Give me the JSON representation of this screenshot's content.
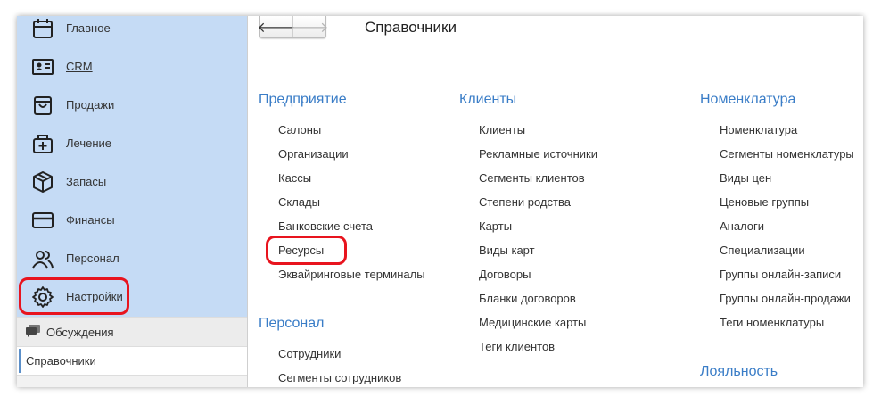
{
  "sidebar": {
    "items": [
      {
        "label": "Главное",
        "icon": "calendar-icon"
      },
      {
        "label": "CRM",
        "icon": "id-card-icon"
      },
      {
        "label": "Продажи",
        "icon": "shopping-bag-icon"
      },
      {
        "label": "Лечение",
        "icon": "medical-bag-icon"
      },
      {
        "label": "Запасы",
        "icon": "box-icon"
      },
      {
        "label": "Финансы",
        "icon": "credit-card-icon"
      },
      {
        "label": "Персонал",
        "icon": "users-icon"
      },
      {
        "label": "Настройки",
        "icon": "gear-icon"
      }
    ],
    "discussions_label": "Обсуждения",
    "current_label": "Справочники"
  },
  "header": {
    "back_glyph": "🡐",
    "forward_glyph": "🡒",
    "title": "Справочники"
  },
  "sections": {
    "enterprise": {
      "title": "Предприятие",
      "items": [
        "Салоны",
        "Организации",
        "Кассы",
        "Склады",
        "Банковские счета",
        "Ресурсы",
        "Эквайринговые терминалы"
      ]
    },
    "personnel": {
      "title": "Персонал",
      "items": [
        "Сотрудники",
        "Сегменты сотрудников"
      ]
    },
    "clients": {
      "title": "Клиенты",
      "items": [
        "Клиенты",
        "Рекламные источники",
        "Сегменты клиентов",
        "Степени родства",
        "Карты",
        "Виды карт",
        "Договоры",
        "Бланки договоров",
        "Медицинские карты",
        "Теги клиентов"
      ]
    },
    "nomenclature": {
      "title": "Номенклатура",
      "items": [
        "Номенклатура",
        "Сегменты номенклатуры",
        "Виды цен",
        "Ценовые группы",
        "Аналоги",
        "Специализации",
        "Группы онлайн-записи",
        "Группы онлайн-продажи",
        "Теги номенклатуры"
      ]
    },
    "loyalty": {
      "title": "Лояльность"
    }
  },
  "colors": {
    "sidebar_bg": "#c5dbf5",
    "group_title": "#3a7dc7",
    "highlight": "#e8141e"
  }
}
